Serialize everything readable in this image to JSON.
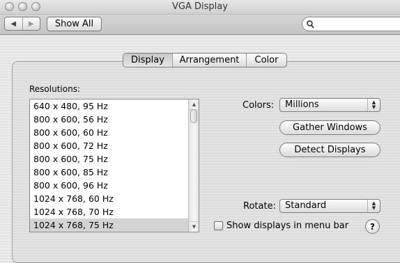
{
  "window": {
    "title": "VGA Display"
  },
  "toolbar": {
    "back_icon": "back-arrow-icon",
    "forward_icon": "forward-arrow-icon",
    "show_all_label": "Show All",
    "search": {
      "value": "",
      "icon": "search-icon"
    }
  },
  "tabs": [
    {
      "label": "Display",
      "selected": true
    },
    {
      "label": "Arrangement",
      "selected": false
    },
    {
      "label": "Color",
      "selected": false
    }
  ],
  "resolutions": {
    "label": "Resolutions:",
    "items": [
      "640 x 480, 95 Hz",
      "800 x 600, 56 Hz",
      "800 x 600, 60 Hz",
      "800 x 600, 72 Hz",
      "800 x 600, 75 Hz",
      "800 x 600, 85 Hz",
      "800 x 600, 96 Hz",
      "1024 x 768, 60 Hz",
      "1024 x 768, 70 Hz",
      "1024 x 768, 75 Hz"
    ],
    "selected_index": 9
  },
  "colors": {
    "label": "Colors:",
    "value": "Millions"
  },
  "buttons": {
    "gather_windows": "Gather Windows",
    "detect_displays": "Detect Displays"
  },
  "rotate": {
    "label": "Rotate:",
    "value": "Standard"
  },
  "menu_bar_checkbox": {
    "label": "Show displays in menu bar",
    "checked": false
  },
  "help": {
    "label": "?"
  }
}
